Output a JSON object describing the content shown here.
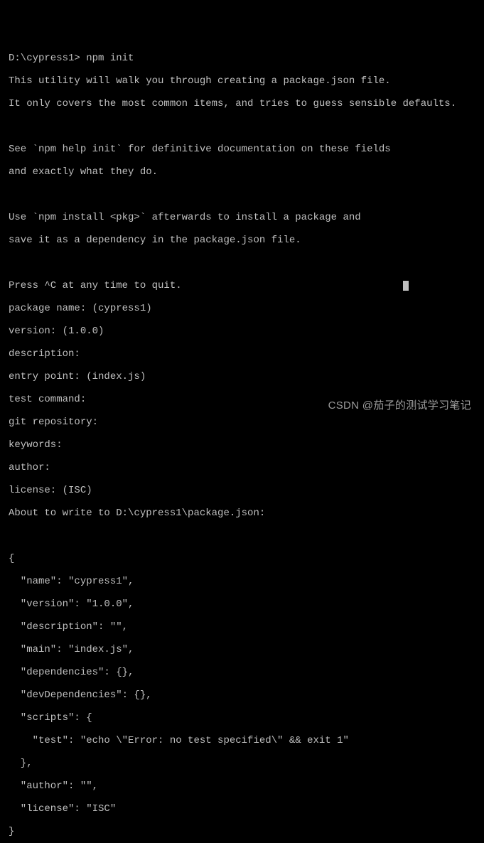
{
  "prompt": {
    "path": "D:\\cypress1>",
    "command": "npm init"
  },
  "intro": {
    "line1": "This utility will walk you through creating a package.json file.",
    "line2": "It only covers the most common items, and tries to guess sensible defaults.",
    "line3": "See `npm help init` for definitive documentation on these fields",
    "line4": "and exactly what they do.",
    "line5": "Use `npm install <pkg>` afterwards to install a package and",
    "line6": "save it as a dependency in the package.json file.",
    "line7": "Press ^C at any time to quit."
  },
  "prompts": {
    "package_name": "package name: (cypress1)",
    "version": "version: (1.0.0)",
    "description": "description:",
    "entry_point": "entry point: (index.js)",
    "test_command": "test command:",
    "git_repository": "git repository:",
    "keywords": "keywords:",
    "author": "author:",
    "license": "license: (ISC)"
  },
  "about_to_write": "About to write to D:\\cypress1\\package.json:",
  "json_output": {
    "open": "{",
    "name": "  \"name\": \"cypress1\",",
    "version": "  \"version\": \"1.0.0\",",
    "description": "  \"description\": \"\",",
    "main": "  \"main\": \"index.js\",",
    "dependencies": "  \"dependencies\": {},",
    "devDependencies": "  \"devDependencies\": {},",
    "scripts_open": "  \"scripts\": {",
    "test": "    \"test\": \"echo \\\"Error: no test specified\\\" && exit 1\"",
    "scripts_close": "  },",
    "author": "  \"author\": \"\",",
    "license": "  \"license\": \"ISC\"",
    "close": "}"
  },
  "watermark": "CSDN @茄子的测试学习笔记"
}
